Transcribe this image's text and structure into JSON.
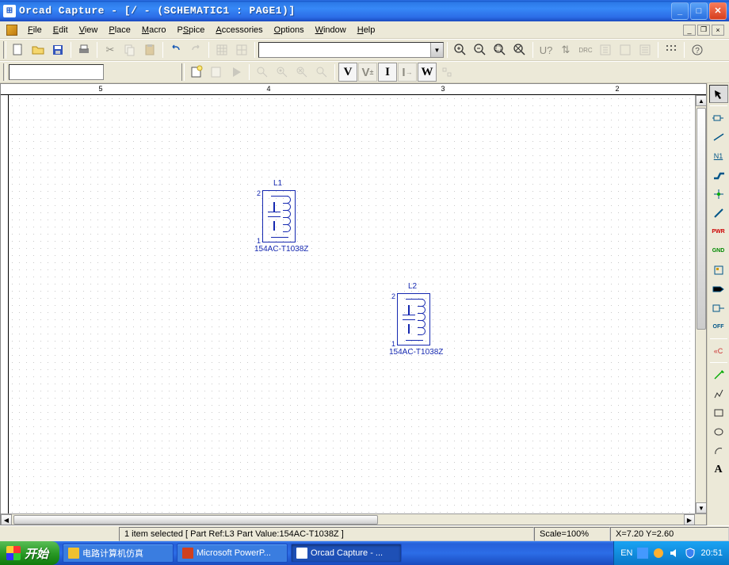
{
  "titlebar": {
    "text": "Orcad Capture - [/ - (SCHEMATIC1 : PAGE1)]"
  },
  "menu": {
    "file": "File",
    "edit": "Edit",
    "view": "View",
    "place": "Place",
    "macro": "Macro",
    "pspice": "PSpice",
    "accessories": "Accessories",
    "options": "Options",
    "window": "Window",
    "help": "Help"
  },
  "ruler": {
    "t5": "5",
    "t4": "4",
    "t3": "3",
    "t2": "2"
  },
  "components": {
    "c1": {
      "name": "L1",
      "value": "154AC-T1038Z",
      "pin_top": "2",
      "pin_bot": "1"
    },
    "c2": {
      "name": "L2",
      "value": "154AC-T1038Z",
      "pin_top": "2",
      "pin_bot": "1"
    }
  },
  "toolbar2": {
    "letters": {
      "v": "V",
      "vu": "V",
      "i": "I",
      "iu": "I",
      "w": "W"
    }
  },
  "palette": {
    "n1": "N1",
    "pwr": "PWR",
    "gnd": "GND",
    "off": "OFF",
    "cc": "«C"
  },
  "status": {
    "main": "1 item selected [ Part Ref:L3 Part Value:154AC-T1038Z ]",
    "scale": "Scale=100%",
    "coords": "X=7.20  Y=2.60"
  },
  "taskbar": {
    "start": "开始",
    "t1": "电路计算机仿真",
    "t2": "Microsoft PowerP...",
    "t3": "Orcad Capture - ...",
    "lang": "EN",
    "clock": "20:51"
  }
}
